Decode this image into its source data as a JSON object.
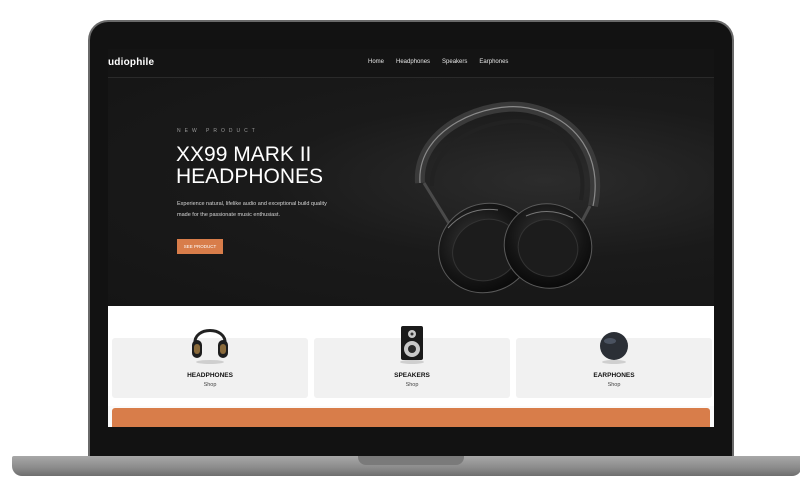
{
  "navbar": {
    "logo": "udiophile",
    "links": [
      "Home",
      "Headphones",
      "Speakers",
      "Earphones"
    ]
  },
  "hero": {
    "eyebrow": "NEW PRODUCT",
    "title": "XX99 MARK II HEADPHONES",
    "description": "Experience natural, lifelike audio and exceptional build quality made for the passionate music enthusiast.",
    "button_label": "SEE PRODUCT"
  },
  "categories": [
    {
      "title": "HEADPHONES",
      "link": "Shop",
      "icon": "headphones-icon"
    },
    {
      "title": "SPEAKERS",
      "link": "Shop",
      "icon": "speaker-icon"
    },
    {
      "title": "EARPHONES",
      "link": "Shop",
      "icon": "earphones-icon"
    }
  ],
  "colors": {
    "accent": "#d87d4a",
    "nav_bg": "#141414",
    "hero_bg": "#1a1a1a",
    "card_bg": "#f1f1f1"
  }
}
